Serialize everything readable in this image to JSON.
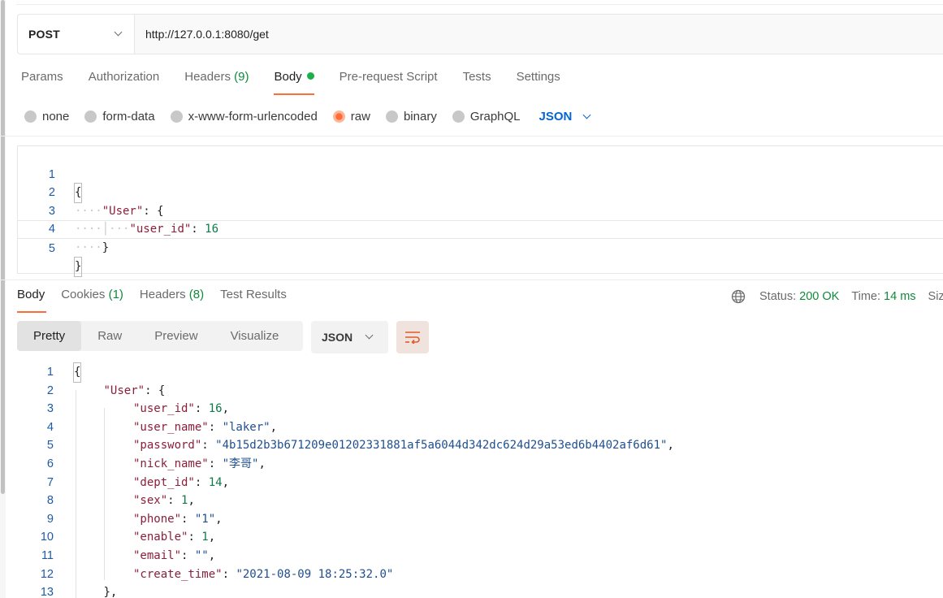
{
  "request": {
    "method": "POST",
    "url": "http://127.0.0.1:8080/get",
    "tabs": [
      {
        "label": "Params",
        "count": ""
      },
      {
        "label": "Authorization",
        "count": ""
      },
      {
        "label": "Headers",
        "count": "(9)"
      },
      {
        "label": "Body",
        "count": ""
      },
      {
        "label": "Pre-request Script",
        "count": ""
      },
      {
        "label": "Tests",
        "count": ""
      },
      {
        "label": "Settings",
        "count": ""
      }
    ],
    "active_tab": "Body",
    "body_types": [
      "none",
      "form-data",
      "x-www-form-urlencoded",
      "raw",
      "binary",
      "GraphQL"
    ],
    "selected_body_type": "raw",
    "body_language": "JSON",
    "body_lines": [
      {
        "n": "1",
        "text": "{"
      },
      {
        "n": "2",
        "text": "    \"User\": {"
      },
      {
        "n": "3",
        "text": "        \"user_id\": 16"
      },
      {
        "n": "4",
        "text": "    }"
      },
      {
        "n": "5",
        "text": "}"
      }
    ]
  },
  "response": {
    "tabs": [
      {
        "label": "Body",
        "count": ""
      },
      {
        "label": "Cookies",
        "count": "(1)"
      },
      {
        "label": "Headers",
        "count": "(8)"
      },
      {
        "label": "Test Results",
        "count": ""
      }
    ],
    "status_label": "Status:",
    "status_value": "200 OK",
    "time_label": "Time:",
    "time_value": "14 ms",
    "size_label": "Size",
    "view_modes": [
      "Pretty",
      "Raw",
      "Preview",
      "Visualize"
    ],
    "active_view": "Pretty",
    "format": "JSON",
    "lines": [
      {
        "n": "1",
        "indent": 0,
        "parts": [
          [
            "p",
            "{"
          ]
        ]
      },
      {
        "n": "2",
        "indent": 1,
        "parts": [
          [
            "k",
            "\"User\""
          ],
          [
            "p",
            ": {"
          ]
        ]
      },
      {
        "n": "3",
        "indent": 2,
        "parts": [
          [
            "k",
            "\"user_id\""
          ],
          [
            "p",
            ": "
          ],
          [
            "n",
            "16"
          ],
          [
            "p",
            ","
          ]
        ]
      },
      {
        "n": "4",
        "indent": 2,
        "parts": [
          [
            "k",
            "\"user_name\""
          ],
          [
            "p",
            ": "
          ],
          [
            "s",
            "\"laker\""
          ],
          [
            "p",
            ","
          ]
        ]
      },
      {
        "n": "5",
        "indent": 2,
        "parts": [
          [
            "k",
            "\"password\""
          ],
          [
            "p",
            ": "
          ],
          [
            "s",
            "\"4b15d2b3b671209e01202331881af5a6044d342dc624d29a53ed6b4402af6d61\""
          ],
          [
            "p",
            ","
          ]
        ]
      },
      {
        "n": "6",
        "indent": 2,
        "parts": [
          [
            "k",
            "\"nick_name\""
          ],
          [
            "p",
            ": "
          ],
          [
            "s",
            "\"李哥\""
          ],
          [
            "p",
            ","
          ]
        ]
      },
      {
        "n": "7",
        "indent": 2,
        "parts": [
          [
            "k",
            "\"dept_id\""
          ],
          [
            "p",
            ": "
          ],
          [
            "n",
            "14"
          ],
          [
            "p",
            ","
          ]
        ]
      },
      {
        "n": "8",
        "indent": 2,
        "parts": [
          [
            "k",
            "\"sex\""
          ],
          [
            "p",
            ": "
          ],
          [
            "n",
            "1"
          ],
          [
            "p",
            ","
          ]
        ]
      },
      {
        "n": "9",
        "indent": 2,
        "parts": [
          [
            "k",
            "\"phone\""
          ],
          [
            "p",
            ": "
          ],
          [
            "s",
            "\"1\""
          ],
          [
            "p",
            ","
          ]
        ]
      },
      {
        "n": "10",
        "indent": 2,
        "parts": [
          [
            "k",
            "\"enable\""
          ],
          [
            "p",
            ": "
          ],
          [
            "n",
            "1"
          ],
          [
            "p",
            ","
          ]
        ]
      },
      {
        "n": "11",
        "indent": 2,
        "parts": [
          [
            "k",
            "\"email\""
          ],
          [
            "p",
            ": "
          ],
          [
            "s",
            "\"\""
          ],
          [
            "p",
            ","
          ]
        ]
      },
      {
        "n": "12",
        "indent": 2,
        "parts": [
          [
            "k",
            "\"create_time\""
          ],
          [
            "p",
            ": "
          ],
          [
            "s",
            "\"2021-08-09 18:25:32.0\""
          ]
        ]
      },
      {
        "n": "13",
        "indent": 1,
        "parts": [
          [
            "p",
            "},"
          ]
        ]
      }
    ]
  },
  "colors": {
    "accent": "#ff6c37",
    "green": "#0f8a3a",
    "link_blue": "#0265d2",
    "json_key": "#8b1f3a",
    "json_string": "#1f4f8e",
    "json_number": "#0f7a4a"
  }
}
